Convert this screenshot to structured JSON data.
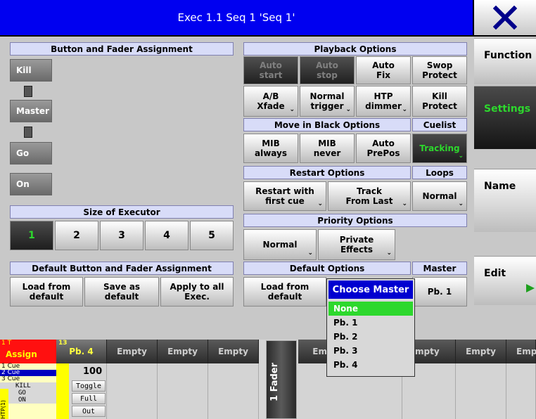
{
  "window": {
    "title": "Exec 1.1 Seq 1 'Seq 1'",
    "close_icon": "close-x-icon"
  },
  "sidebar": {
    "items": [
      {
        "label": "Function"
      },
      {
        "label": "Settings",
        "active": true
      },
      {
        "label": "Name"
      },
      {
        "label": "Edit",
        "icon": "play-arrow-icon"
      }
    ]
  },
  "button_fader": {
    "header": "Button and Fader Assignment",
    "labels": [
      "Kill",
      "Master",
      "Go",
      "On"
    ]
  },
  "size": {
    "header": "Size of Executor",
    "options": [
      "1",
      "2",
      "3",
      "4",
      "5"
    ],
    "selected": "1"
  },
  "default_assign": {
    "header": "Default Button and Fader Assignment",
    "load": "Load from default",
    "save": "Save as default",
    "apply": "Apply to all Exec."
  },
  "playback": {
    "header": "Playback Options",
    "row1": [
      "Auto start",
      "Auto stop",
      "Auto Fix",
      "Swop Protect"
    ],
    "row2": [
      "A/B Xfade",
      "Normal trigger",
      "HTP dimmer",
      "Kill Protect"
    ]
  },
  "move_black": {
    "header": "Move in Black Options",
    "cuelist_header": "Cuelist",
    "options": [
      "MIB always",
      "MIB never",
      "Auto PrePos"
    ],
    "cuelist_value": "Tracking"
  },
  "restart": {
    "header": "Restart Options",
    "loops_header": "Loops",
    "options": [
      "Restart with first cue",
      "Track From Last"
    ],
    "loops_value": "Normal"
  },
  "priority": {
    "header": "Priority Options",
    "options": [
      "Normal",
      "Private Effects"
    ]
  },
  "default_options": {
    "header": "Default Options",
    "master_header": "Master",
    "load": "Load from default",
    "master_value": "Pb. 1"
  },
  "dropdown": {
    "title": "Choose Master",
    "items": [
      "None",
      "Pb. 1",
      "Pb. 2",
      "Pb. 3",
      "Pb. 4"
    ],
    "selected": "None"
  },
  "bottom": {
    "assign_num": "1 T",
    "assign_label": "Assign",
    "pb_num": "13",
    "pb_label": "Pb. 4",
    "empty": [
      "Empty",
      "Empty",
      "Empty",
      "Em",
      "mpty",
      "Empty",
      "Emp"
    ],
    "fader_label": "1 Fader",
    "cues": [
      "1 Cue",
      "2 Cue",
      "3 Cue",
      "KILL",
      "GO",
      "ON"
    ],
    "htp_label": "HTP(1)",
    "pb_value": "100",
    "pb_buttons": [
      "Toggle",
      "Full",
      "Out"
    ]
  }
}
